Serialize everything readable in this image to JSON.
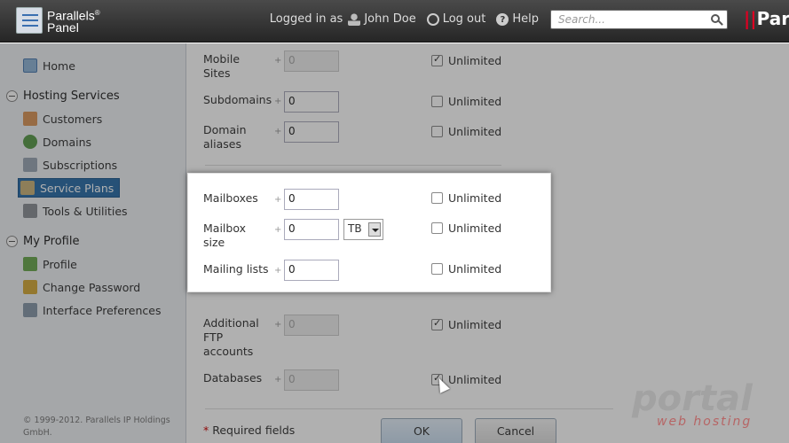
{
  "header": {
    "logo_line1": "Parallels",
    "logo_sup": "®",
    "logo_line2": "Panel",
    "logged_in_as": "Logged in as",
    "user_name": "John Doe",
    "logout": "Log out",
    "help": "Help",
    "search_placeholder": "Search...",
    "brand_right_mark": "||",
    "brand_right_text": "Par"
  },
  "sidebar": {
    "home": "Home",
    "hosting_services": "Hosting Services",
    "customers": "Customers",
    "domains": "Domains",
    "subscriptions": "Subscriptions",
    "service_plans": "Service Plans",
    "tools": "Tools & Utilities",
    "my_profile": "My Profile",
    "profile": "Profile",
    "change_password": "Change Password",
    "interface_prefs": "Interface Preferences",
    "copyright": "© 1999-2012. Parallels IP Holdings GmbH."
  },
  "form": {
    "plus": "+",
    "unlimited": "Unlimited",
    "mobile_sites_l1": "Mobile",
    "mobile_sites_l2": "Sites",
    "mobile_sites_value": "0",
    "subdomains": "Subdomains",
    "subdomains_value": "0",
    "domain_aliases_l1": "Domain",
    "domain_aliases_l2": "aliases",
    "domain_aliases_value": "0",
    "mailboxes": "Mailboxes",
    "mailboxes_value": "0",
    "mailbox_size_l1": "Mailbox",
    "mailbox_size_l2": "size",
    "mailbox_size_value": "0",
    "mailbox_size_unit": "TB",
    "mailing_lists": "Mailing lists",
    "mailing_lists_value": "0",
    "ftp_l1": "Additional",
    "ftp_l2": "FTP",
    "ftp_l3": "accounts",
    "ftp_value": "0",
    "databases": "Databases",
    "databases_value": "0",
    "required_star": "*",
    "required_text": " Required fields",
    "ok": "OK",
    "cancel": "Cancel"
  },
  "watermark": {
    "line1": "portal",
    "line2": "web hosting"
  }
}
